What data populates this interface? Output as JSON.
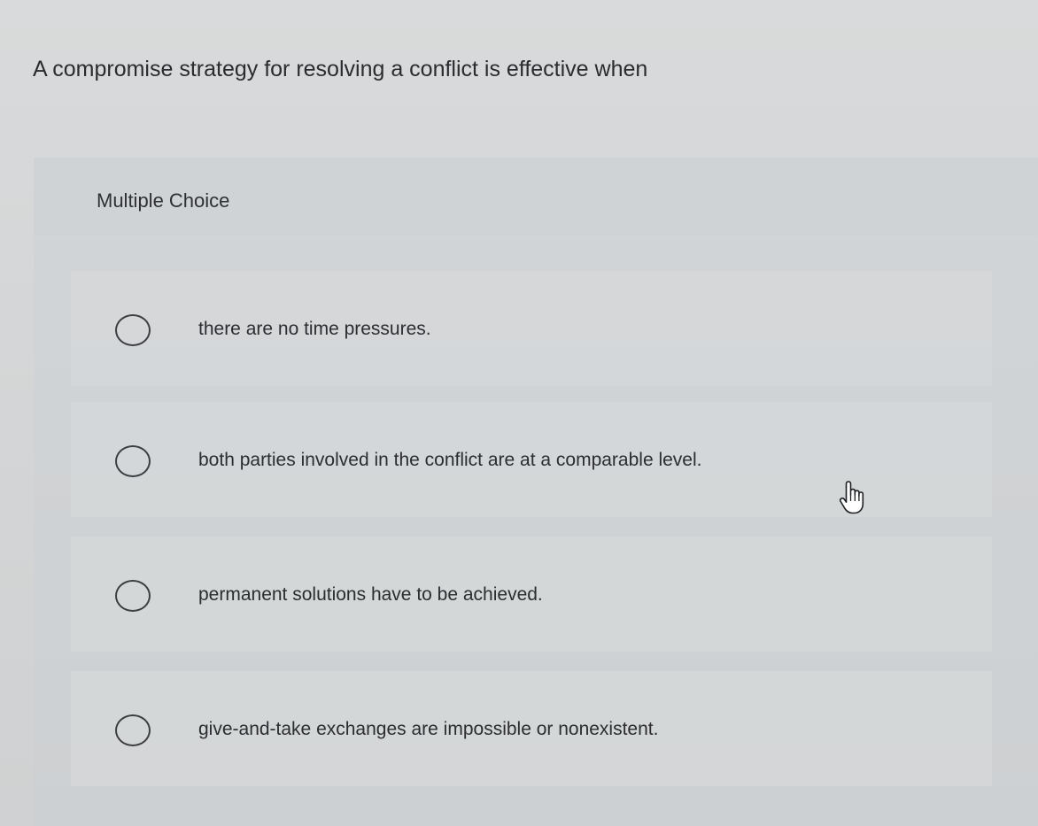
{
  "question": {
    "text": "A compromise strategy for resolving a conflict is effective when"
  },
  "card": {
    "type_label": "Multiple Choice",
    "options": [
      {
        "label": "there are no time pressures.",
        "selected": false
      },
      {
        "label": "both parties involved in the conflict are at a comparable level.",
        "selected": false
      },
      {
        "label": "permanent solutions have to be achieved.",
        "selected": false
      },
      {
        "label": "give-and-take exchanges are impossible or nonexistent.",
        "selected": false
      }
    ]
  },
  "cursor": {
    "icon": "hand-pointer-icon"
  },
  "colors": {
    "background": "#d4d6d7",
    "card": "#cfd2d4",
    "text": "#2b2d30",
    "radio_border": "#3c3e42"
  }
}
